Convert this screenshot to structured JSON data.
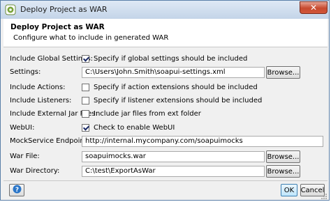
{
  "window": {
    "title": "Deploy Project as WAR",
    "close_glyph": "✕"
  },
  "header": {
    "title": "Deploy Project as WAR",
    "subtitle": "Configure what to include in generated WAR"
  },
  "form": {
    "include_global_settings": {
      "label": "Include Global Settings:",
      "checked": true,
      "text": "Specify if global settings should be included"
    },
    "settings": {
      "label": "Settings:",
      "value": "C:\\Users\\John.Smith\\soapui-settings.xml",
      "browse": "Browse..."
    },
    "include_actions": {
      "label": "Include Actions:",
      "checked": false,
      "text": "Specify if action extensions should be included"
    },
    "include_listeners": {
      "label": "Include Listeners:",
      "checked": false,
      "text": "Specify if listener extensions should be included"
    },
    "include_external_jar_files": {
      "label": "Include External Jar Files:",
      "checked": false,
      "text": "Include jar files from ext folder"
    },
    "webui": {
      "label": "WebUI:",
      "checked": true,
      "text": "Check to enable WebUI"
    },
    "mockservice_endpoint": {
      "label": "MockService Endpoint:",
      "value": "http://internal.mycompany.com/soapuimocks"
    },
    "war_file": {
      "label": "War File:",
      "value": "soapuimocks.war",
      "browse": "Browse..."
    },
    "war_directory": {
      "label": "War Directory:",
      "value": "C:\\test\\ExportAsWar",
      "browse": "Browse..."
    }
  },
  "footer": {
    "ok": "OK",
    "cancel": "Cancel"
  },
  "icons": {
    "app": "soapui-app-icon",
    "help": "help-icon",
    "close": "close-icon"
  },
  "colors": {
    "titlebar": "#c3d4e8",
    "close": "#c74a2f",
    "help": "#2b76c8"
  }
}
